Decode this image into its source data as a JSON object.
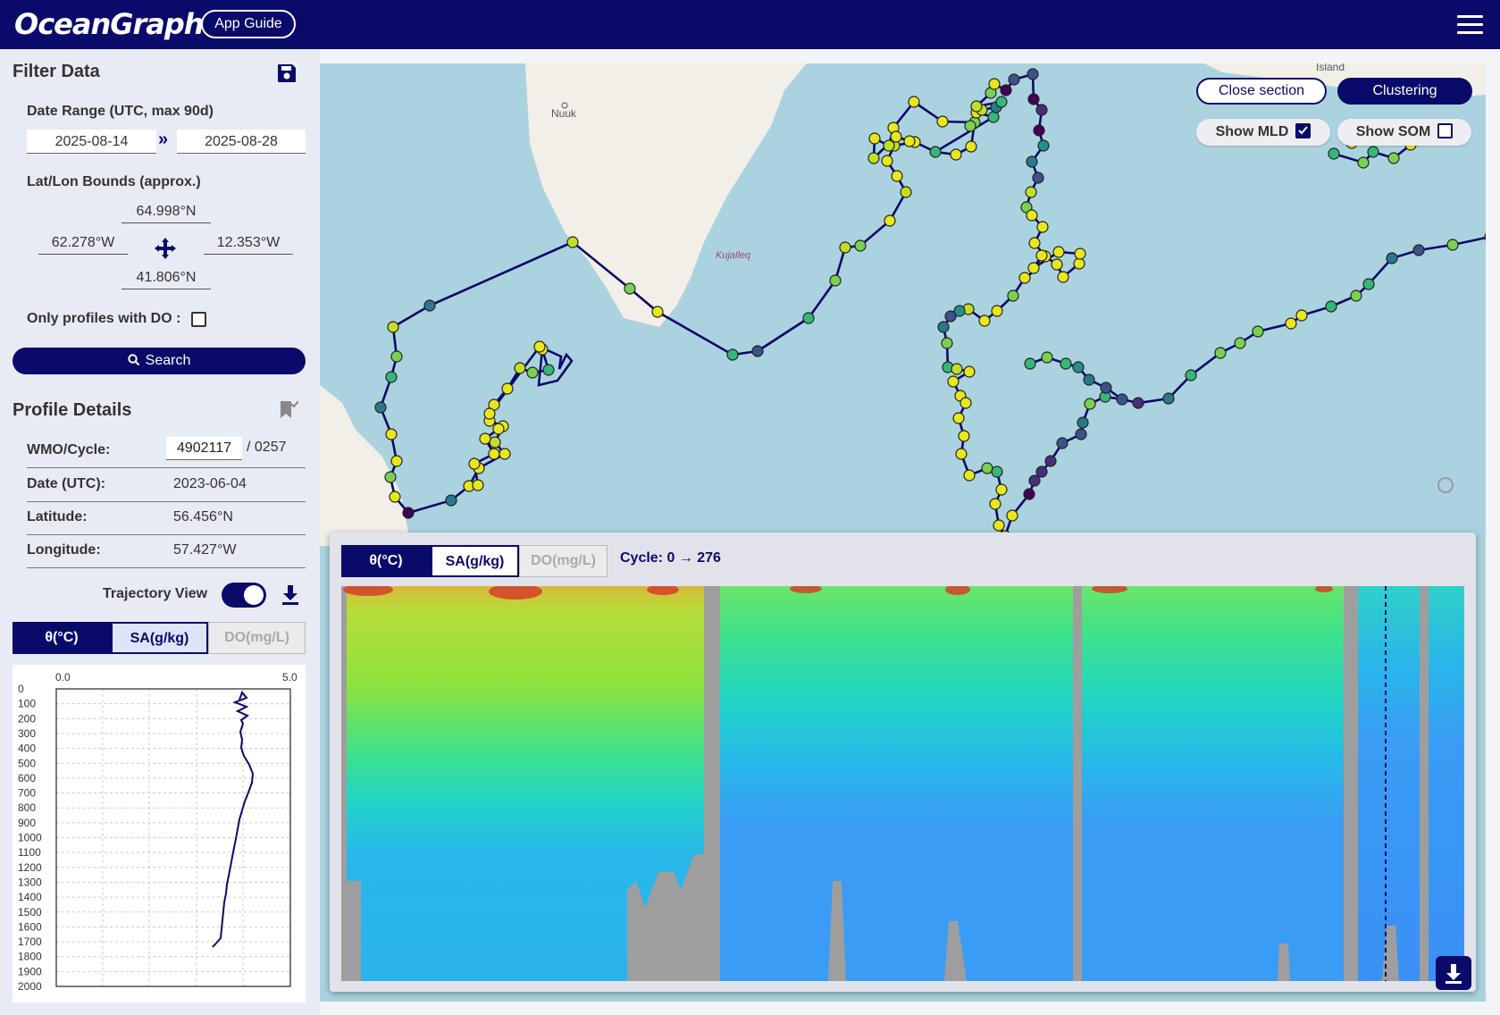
{
  "header": {
    "logo": "OceanGraph",
    "guide_label": "App Guide"
  },
  "filter": {
    "title": "Filter Data",
    "date_label": "Date Range (UTC, max 90d)",
    "date_from": "2025-08-14",
    "date_sep": "»",
    "date_to": "2025-08-28",
    "bounds_label": "Lat/Lon Bounds (approx.)",
    "north": "64.998°N",
    "west": "62.278°W",
    "east": "12.353°W",
    "south": "41.806°N",
    "do_only_label": "Only profiles with DO :",
    "search_label": "Search"
  },
  "details": {
    "title": "Profile Details",
    "wmo_label": "WMO/Cycle:",
    "wmo": "4902117",
    "cycle": "/ 0257",
    "date_label": "Date (UTC):",
    "date": "2023-06-04",
    "lat_label": "Latitude:",
    "lat": "56.456°N",
    "lon_label": "Longitude:",
    "lon": "57.427°W",
    "trajectory_label": "Trajectory View",
    "trajectory_on": true
  },
  "var_tabs": [
    {
      "label": "θ(°C)",
      "state": "active"
    },
    {
      "label": "SA(g/kg)",
      "state": "selected"
    },
    {
      "label": "DO(mg/L)",
      "state": "disabled"
    }
  ],
  "profile_plot": {
    "x_min": "0.0",
    "x_max": "5.0",
    "depth_ticks": [
      "0",
      "100",
      "200",
      "300",
      "400",
      "500",
      "600",
      "700",
      "800",
      "900",
      "1000",
      "1100",
      "1200",
      "1300",
      "1400",
      "1500",
      "1600",
      "1700",
      "1800",
      "1900",
      "2000"
    ]
  },
  "map": {
    "labels": {
      "nuuk": "Nuuk",
      "kujalleq": "Kujalleq",
      "island": "Ísland"
    },
    "close_section_label": "Close section",
    "clustering_label": "Clustering",
    "show_mld_label": "Show MLD",
    "show_mld_checked": true,
    "show_som_label": "Show SOM",
    "show_som_checked": false
  },
  "section": {
    "tabs": [
      {
        "label": "θ(°C)",
        "state": "active"
      },
      {
        "label": "SA(g/kg)",
        "state": "outline"
      },
      {
        "label": "DO(mg/L)",
        "state": "disabled"
      }
    ],
    "cycle_range": "Cycle: 0 → 276"
  },
  "colors": {
    "brand": "#0a0a6a",
    "ocean": "#abd3df",
    "land": "#f2efe9"
  }
}
